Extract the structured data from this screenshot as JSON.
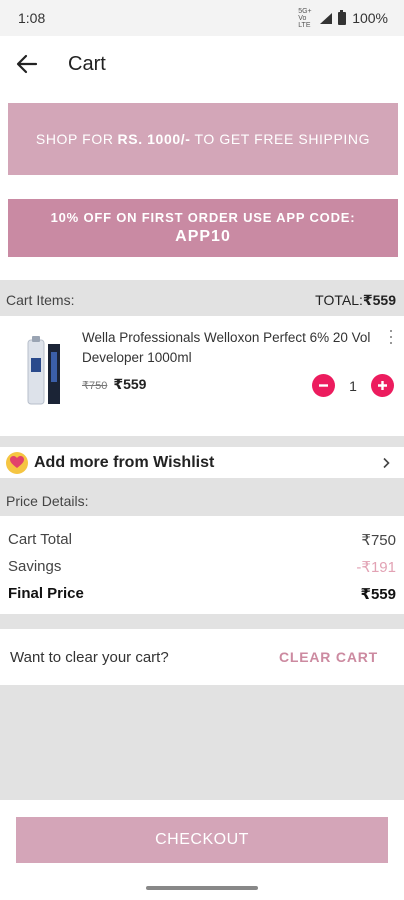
{
  "status_bar": {
    "time": "1:08",
    "network": "5G+ Vo LTE",
    "battery": "100%"
  },
  "header": {
    "title": "Cart",
    "back_icon": "arrow-left-icon"
  },
  "promo": {
    "shipping_pre": "SHOP FOR",
    "shipping_amount": "RS. 1000/-",
    "shipping_post": "TO GET FREE SHIPPING",
    "first_order_line": "10% OFF ON FIRST ORDER  USE APP CODE:",
    "first_order_code": "APP10"
  },
  "cart": {
    "items_label": "Cart Items:",
    "total_label": "TOTAL:",
    "total_value": "₹559",
    "items": [
      {
        "name": "Wella Professionals Welloxon Perfect 6% 20 Vol Developer 1000ml",
        "old_price": "₹750",
        "price": "₹559",
        "quantity": "1"
      }
    ]
  },
  "wishlist": {
    "label": "Add more from Wishlist",
    "icon": "heart-icon"
  },
  "price_details": {
    "header": "Price Details:",
    "rows": [
      {
        "label": "Cart Total",
        "value": "₹750"
      },
      {
        "label": "Savings",
        "value": "-₹191"
      },
      {
        "label": "Final Price",
        "value": "₹559"
      }
    ]
  },
  "clear_cart": {
    "question": "Want to clear your cart?",
    "button": "CLEAR CART"
  },
  "checkout": {
    "label": "CHECKOUT"
  },
  "colors": {
    "accent_pink": "#ec1c5e",
    "banner_light": "#d3a6b8",
    "banner_dark": "#c98aa3",
    "checkout_bg": "#d4a5b8"
  }
}
